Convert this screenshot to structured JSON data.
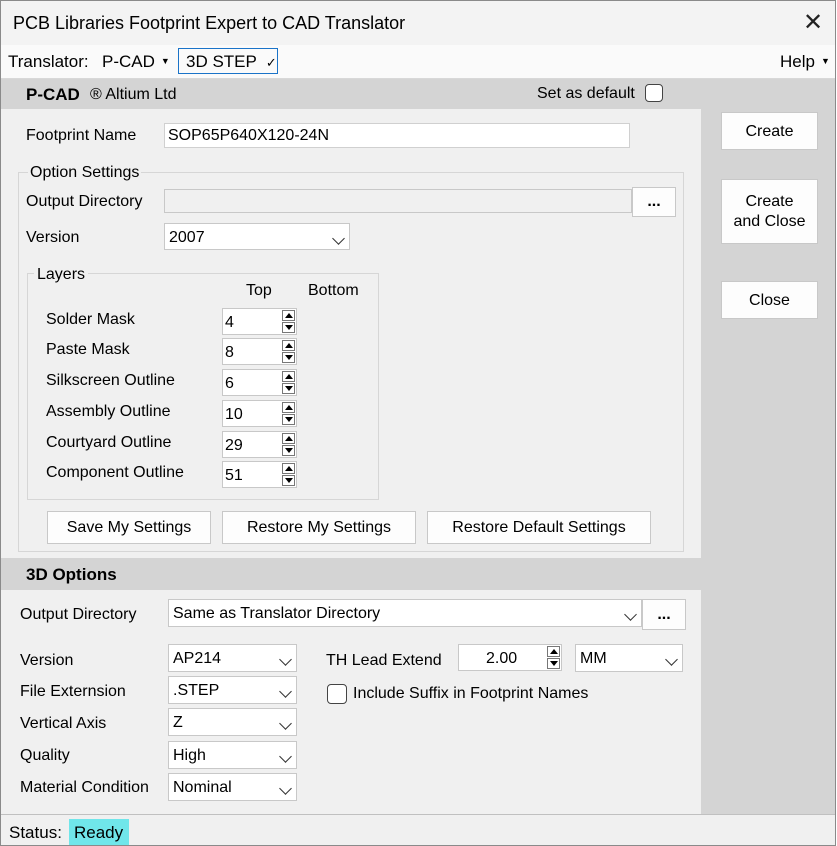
{
  "window": {
    "title": "PCB Libraries Footprint Expert to CAD Translator"
  },
  "menubar": {
    "translator_label": "Translator:",
    "pcad_label": "P-CAD",
    "step_label": "3D STEP",
    "step_check": "✓",
    "help_label": "Help"
  },
  "pcad_section": {
    "heading": "P-CAD",
    "vendor": "® Altium Ltd",
    "set_default_label": "Set as default",
    "set_default_checked": false,
    "footprint_name_label": "Footprint Name",
    "footprint_name_value": "SOP65P640X120-24N",
    "option_settings_label": "Option Settings",
    "output_directory_label": "Output Directory",
    "output_directory_value": "",
    "browse_label": "...",
    "version_label": "Version",
    "version_value": "2007",
    "layers": {
      "group_label": "Layers",
      "col_top": "Top",
      "col_bottom": "Bottom",
      "rows": [
        {
          "label": "Solder Mask",
          "top": "4"
        },
        {
          "label": "Paste Mask",
          "top": "8"
        },
        {
          "label": "Silkscreen Outline",
          "top": "6"
        },
        {
          "label": "Assembly Outline",
          "top": "10"
        },
        {
          "label": "Courtyard Outline",
          "top": "29"
        },
        {
          "label": "Component Outline",
          "top": "51"
        }
      ]
    },
    "save_settings_label": "Save My Settings",
    "restore_settings_label": "Restore My Settings",
    "restore_default_label": "Restore Default Settings"
  },
  "side_buttons": {
    "create_label": "Create",
    "create_close_line1": "Create",
    "create_close_line2": "and Close",
    "close_label": "Close"
  },
  "options_3d": {
    "heading": "3D Options",
    "output_directory_label": "Output Directory",
    "output_directory_value": "Same as Translator Directory",
    "browse_label": "...",
    "version_label": "Version",
    "version_value": "AP214",
    "file_extension_label": "File Externsion",
    "file_extension_value": ".STEP",
    "vertical_axis_label": "Vertical Axis",
    "vertical_axis_value": "Z",
    "quality_label": "Quality",
    "quality_value": "High",
    "material_condition_label": "Material Condition",
    "material_condition_value": "Nominal",
    "th_lead_extend_label": "TH Lead Extend",
    "th_lead_extend_value": "2.00",
    "units_value": "MM",
    "include_suffix_label": "Include Suffix in Footprint Names",
    "include_suffix_checked": false
  },
  "status": {
    "label": "Status:",
    "value": "Ready",
    "value_color": "#70e6ea"
  }
}
